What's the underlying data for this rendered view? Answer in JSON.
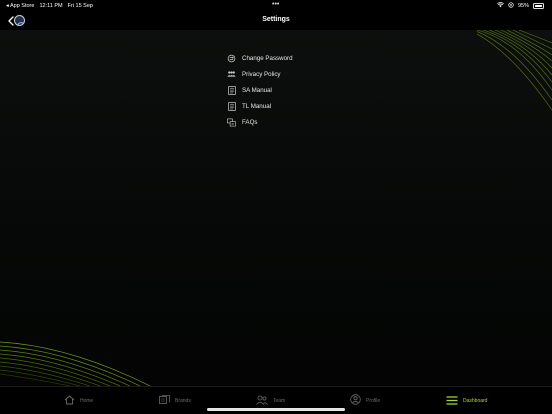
{
  "status_bar": {
    "back_app": "◂ App Store",
    "time": "12:11 PM",
    "date": "Fri 15 Sep",
    "dots": "•••",
    "battery": "95%",
    "battery_level": 0.95
  },
  "nav": {
    "title": "Settings"
  },
  "menu": {
    "items": [
      {
        "label": "Change Password",
        "icon": "refresh-icon"
      },
      {
        "label": "Privacy Policy",
        "icon": "users-icon"
      },
      {
        "label": "SA Manual",
        "icon": "document-icon"
      },
      {
        "label": "TL Manual",
        "icon": "document-icon"
      },
      {
        "label": "FAQs",
        "icon": "faq-icon"
      }
    ]
  },
  "tabs": [
    {
      "label": "Home",
      "icon": "home-icon"
    },
    {
      "label": "Brands",
      "icon": "brands-icon"
    },
    {
      "label": "Team",
      "icon": "team-icon"
    },
    {
      "label": "Profile",
      "icon": "profile-icon"
    },
    {
      "label": "Dashboard",
      "icon": "menu-icon",
      "active": true
    }
  ],
  "colors": {
    "accent": "#a6d92a",
    "background": "#000000",
    "inactive": "#6a6a6a"
  }
}
